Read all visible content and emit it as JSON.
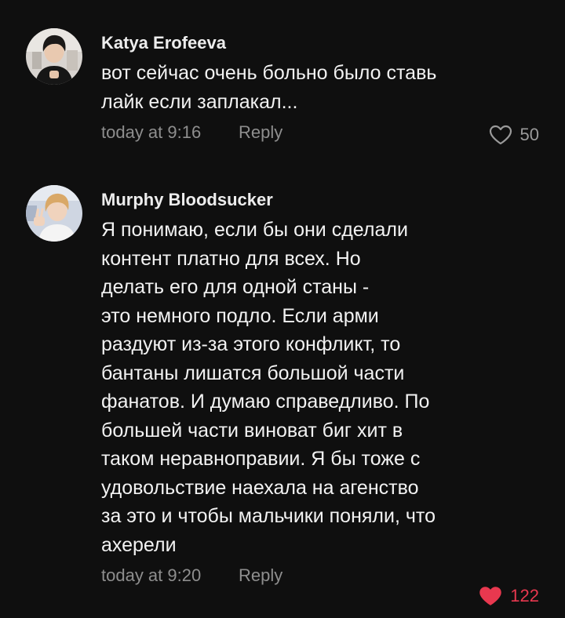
{
  "comments": [
    {
      "author": "Katya Erofeeva",
      "avatar_icon": "user-photo-avatar",
      "lines": [
        "вот сейчас очень больно было ставь",
        "лайк если заплакал..."
      ],
      "time": "today at 9:16",
      "reply_label": "Reply",
      "likes": "50",
      "liked": false,
      "like_icon": "heart-outline-icon"
    },
    {
      "author": "Murphy Bloodsucker",
      "avatar_icon": "user-photo-avatar",
      "lines": [
        "Я понимаю, если бы они сделали",
        "контент платно для всех. Но",
        "делать его для одной станы -",
        "это немного подло. Если арми",
        "раздуют из-за этого конфликт, то",
        "бантаны лишатся большой части",
        "фанатов. И думаю справедливо. По",
        "большей части виноват биг хит в",
        "таком неравноправии. Я бы тоже с",
        "удовольствие наехала на агенство",
        "за это и чтобы мальчики поняли, что",
        "ахерели"
      ],
      "time": "today at 9:20",
      "reply_label": "Reply",
      "likes": "122",
      "liked": true,
      "like_icon": "heart-filled-icon"
    }
  ],
  "colors": {
    "background": "#0f0f0f",
    "text": "#f2f2f2",
    "meta": "#8e8e8e",
    "like_active": "#e8384f"
  }
}
